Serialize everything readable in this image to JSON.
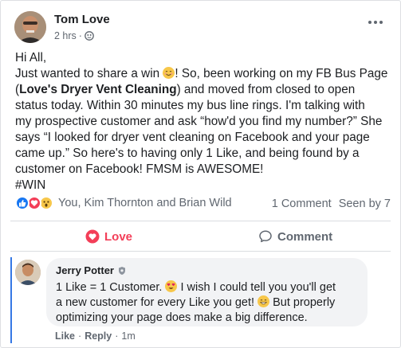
{
  "post": {
    "author": "Tom Love",
    "time": "2 hrs",
    "line1": "Hi All,",
    "line2_a": "Just wanted to share a win ",
    "line2_b": "! So, been working on my FB Bus Page",
    "line3_open": "(",
    "page_name": "Love's Dryer Vent Cleaning",
    "line3_rest": ") and moved from closed to open",
    "line4": "status today. Within 30 minutes my bus line rings. I'm talking with",
    "line5": "my prospective customer and ask “how'd you find my number?” She",
    "line6": "says “I looked for dryer vent cleaning on Facebook and your page",
    "line7": "came up.” So here's to having only 1 Like, and being found by a",
    "line8": "customer on Facebook! FMSM is AWESOME!",
    "hashtag": "#WIN"
  },
  "stats": {
    "reactors": "You, Kim Thornton and Brian Wild",
    "comments": "1 Comment",
    "seen": "Seen by 7"
  },
  "actions": {
    "love": "Love",
    "comment": "Comment"
  },
  "comment": {
    "author": "Jerry Potter",
    "t1": "1 Like = 1 Customer. ",
    "t2": " I wish I could tell you you'll get",
    "t3": "a new customer for every Like you get! ",
    "t4": " But properly",
    "t5": "optimizing your page does make a big difference.",
    "like": "Like",
    "reply": "Reply",
    "time": "1m"
  },
  "colors": {
    "accent_blue": "#1877f2",
    "love_red": "#f33e58",
    "reply_bar": "#3578e5"
  }
}
